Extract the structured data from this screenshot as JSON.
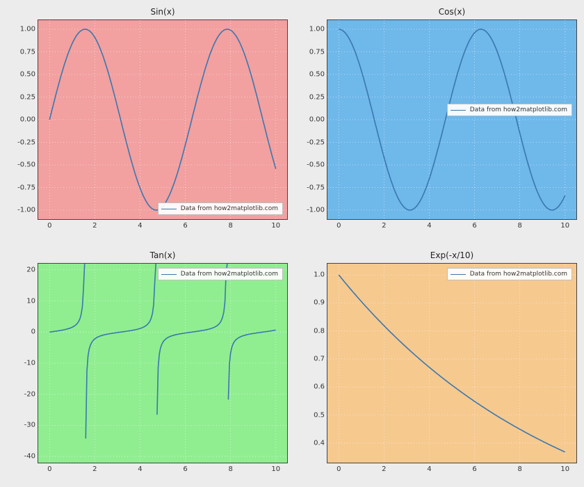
{
  "line_color": "#3977af",
  "legend_label": "Data from how2matplotlib.com",
  "panels": {
    "sin": {
      "title": "Sin(x)",
      "bg": "#f2a0a0",
      "xlim": [
        -0.5,
        10.5
      ],
      "ylim": [
        -1.1,
        1.1
      ],
      "xticks": [
        0,
        2,
        4,
        6,
        8,
        10
      ],
      "yticks": [
        -1.0,
        -0.75,
        -0.5,
        -0.25,
        0.0,
        0.25,
        0.5,
        0.75,
        1.0
      ],
      "ytick_fmt": 2,
      "legend_pos": "bottom-right"
    },
    "cos": {
      "title": "Cos(x)",
      "bg": "#6fb8ea",
      "xlim": [
        -0.5,
        10.5
      ],
      "ylim": [
        -1.1,
        1.1
      ],
      "xticks": [
        0,
        2,
        4,
        6,
        8,
        10
      ],
      "yticks": [
        -1.0,
        -0.75,
        -0.5,
        -0.25,
        0.0,
        0.25,
        0.5,
        0.75,
        1.0
      ],
      "ytick_fmt": 2,
      "legend_pos": "middle-right"
    },
    "tan": {
      "title": "Tan(x)",
      "bg": "#90ee90",
      "xlim": [
        -0.5,
        10.5
      ],
      "ylim": [
        -42,
        22
      ],
      "xticks": [
        0,
        2,
        4,
        6,
        8,
        10
      ],
      "yticks": [
        -40,
        -30,
        -20,
        -10,
        0,
        10,
        20
      ],
      "ytick_fmt": 0,
      "legend_pos": "top-right"
    },
    "exp": {
      "title": "Exp(-x/10)",
      "bg": "#f6c98f",
      "xlim": [
        -0.5,
        10.5
      ],
      "ylim": [
        0.33,
        1.04
      ],
      "xticks": [
        0,
        2,
        4,
        6,
        8,
        10
      ],
      "yticks": [
        0.4,
        0.5,
        0.6,
        0.7,
        0.8,
        0.9,
        1.0
      ],
      "ytick_fmt": 1,
      "legend_pos": "top-right"
    }
  },
  "chart_data": [
    {
      "id": "sin",
      "type": "line",
      "title": "Sin(x)",
      "xlabel": "",
      "ylabel": "",
      "xlim": [
        -0.5,
        10.5
      ],
      "ylim": [
        -1.1,
        1.1
      ],
      "series": [
        {
          "name": "Data from how2matplotlib.com",
          "fn": "sin",
          "x_range": [
            0,
            10
          ],
          "n": 200
        }
      ]
    },
    {
      "id": "cos",
      "type": "line",
      "title": "Cos(x)",
      "xlabel": "",
      "ylabel": "",
      "xlim": [
        -0.5,
        10.5
      ],
      "ylim": [
        -1.1,
        1.1
      ],
      "series": [
        {
          "name": "Data from how2matplotlib.com",
          "fn": "cos",
          "x_range": [
            0,
            10
          ],
          "n": 200
        }
      ]
    },
    {
      "id": "tan",
      "type": "line",
      "title": "Tan(x)",
      "xlabel": "",
      "ylabel": "",
      "xlim": [
        -0.5,
        10.5
      ],
      "ylim": [
        -42,
        22
      ],
      "series": [
        {
          "name": "Data from how2matplotlib.com",
          "fn": "tan",
          "x_range": [
            0,
            10
          ],
          "n": 200
        }
      ]
    },
    {
      "id": "exp",
      "type": "line",
      "title": "Exp(-x/10)",
      "xlabel": "",
      "ylabel": "",
      "xlim": [
        -0.5,
        10.5
      ],
      "ylim": [
        0.33,
        1.04
      ],
      "series": [
        {
          "name": "Data from how2matplotlib.com",
          "fn": "exp_neg_x_over_10",
          "x_range": [
            0,
            10
          ],
          "n": 200
        }
      ]
    }
  ]
}
